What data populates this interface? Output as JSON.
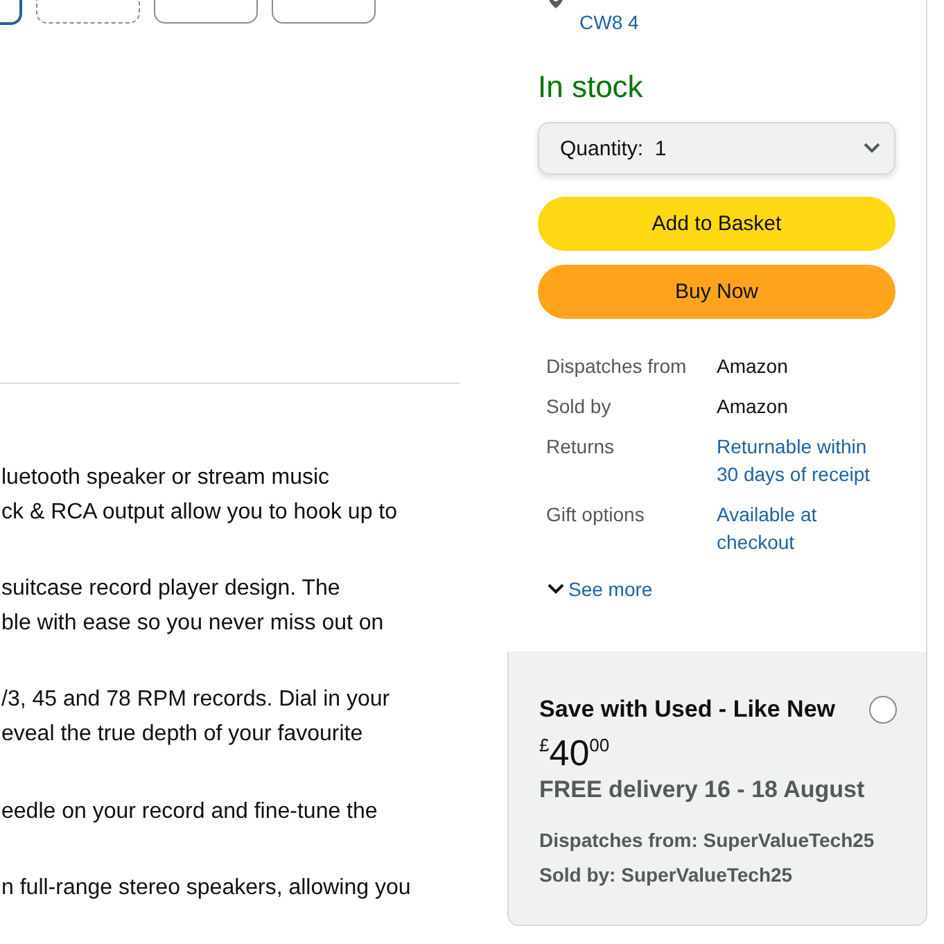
{
  "thumbnails": [
    {
      "kind": "plain",
      "selected": true
    },
    {
      "kind": "dashed",
      "selected": false
    },
    {
      "kind": "plain",
      "selected": false
    },
    {
      "kind": "plain",
      "selected": false
    }
  ],
  "features": [
    {
      "lines": [
        "luetooth speaker or stream music",
        "ck & RCA output allow you to hook up to"
      ]
    },
    {
      "lines": [
        "suitcase record player design. The",
        "ble with ease so you never miss out on"
      ]
    },
    {
      "lines": [
        "/3, 45 and 78 RPM records. Dial in your",
        "eveal the true depth of your favourite"
      ]
    },
    {
      "lines": [
        "eedle on your record and fine-tune the"
      ]
    },
    {
      "lines": [
        "n full-range stereo speakers, allowing you"
      ]
    }
  ],
  "buy_box": {
    "delivery_location": "CW8 4",
    "stock": "In stock",
    "quantity": {
      "label": "Quantity:",
      "value": "1"
    },
    "buttons": [
      {
        "kind": "basket",
        "label": "Add to Basket"
      },
      {
        "kind": "buy",
        "label": "Buy Now"
      }
    ],
    "details": [
      {
        "label": "Dispatches from",
        "value": "Amazon",
        "link": false
      },
      {
        "label": "Sold by",
        "value": "Amazon",
        "link": false
      },
      {
        "label": "Returns",
        "value": "Returnable within 30 days of receipt",
        "link": true
      },
      {
        "label": "Gift options",
        "value": "Available at checkout",
        "link": true
      }
    ],
    "see_more": "See more"
  },
  "used_offer": {
    "title": "Save with Used - Like New",
    "selected": false,
    "price": {
      "currency": "£",
      "whole": "40",
      "fraction": "00"
    },
    "delivery": "FREE delivery 16 - 18 August",
    "dispatches": "Dispatches from: SuperValueTech25",
    "sold_by": "Sold by: SuperValueTech25"
  }
}
